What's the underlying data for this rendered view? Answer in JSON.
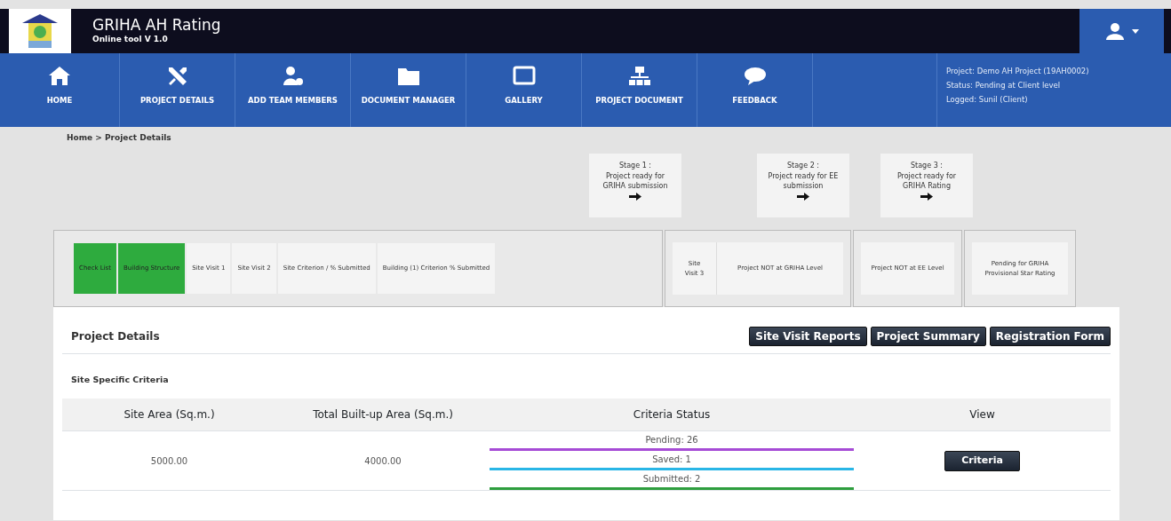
{
  "header": {
    "title": "GRIHA AH Rating",
    "subtitle": "Online tool V 1.0"
  },
  "nav": [
    {
      "label": "HOME"
    },
    {
      "label": "PROJECT DETAILS"
    },
    {
      "label": "ADD TEAM MEMBERS"
    },
    {
      "label": "DOCUMENT MANAGER"
    },
    {
      "label": "GALLERY"
    },
    {
      "label": "PROJECT DOCUMENT"
    },
    {
      "label": "FEEDBACK"
    }
  ],
  "project_info": [
    "Project: Demo AH Project (19AH0002)",
    "Status: Pending at Client level",
    "Logged: Sunil (Client)"
  ],
  "breadcrumb": "Home > Project Details",
  "stages": [
    {
      "title": "Stage 1 :",
      "text": "Project ready for GRIHA submission"
    },
    {
      "title": "Stage 2 :",
      "text": "Project ready for EE submission"
    },
    {
      "title": "Stage 3 :",
      "text": "Project ready for GRIHA Rating"
    }
  ],
  "steps": [
    {
      "label": "Check List",
      "done": true
    },
    {
      "label": "Building Structure",
      "done": true
    },
    {
      "label": "Site Visit 1",
      "done": false
    },
    {
      "label": "Site Visit 2",
      "done": false
    },
    {
      "label": "Site Criterion / % Submitted",
      "done": false
    },
    {
      "label": "Building (1) Criterion % Submitted",
      "done": false
    }
  ],
  "stage_steps": [
    [
      "Site Visit 3",
      "Project NOT at GRIHA Level"
    ],
    [
      "Project NOT at EE Level"
    ],
    [
      "Pending for GRIHA Provisional Star Rating"
    ]
  ],
  "panel": {
    "title": "Project Details",
    "buttons": [
      "Site Visit Reports",
      "Project Summary",
      "Registration Form"
    ],
    "section": "Site Specific Criteria"
  },
  "table": {
    "columns": [
      "Site Area (Sq.m.)",
      "Total Built-up Area (Sq.m.)",
      "Criteria Status",
      "View"
    ],
    "rows": [
      {
        "site_area": "5000.00",
        "built_up_area": "4000.00",
        "statuses": [
          {
            "text": "Pending: 26",
            "color": "#a64bd6"
          },
          {
            "text": "Saved: 1",
            "color": "#29b6e6"
          },
          {
            "text": "Submitted: 2",
            "color": "#2e9e3e"
          }
        ],
        "button": "Criteria"
      }
    ]
  }
}
